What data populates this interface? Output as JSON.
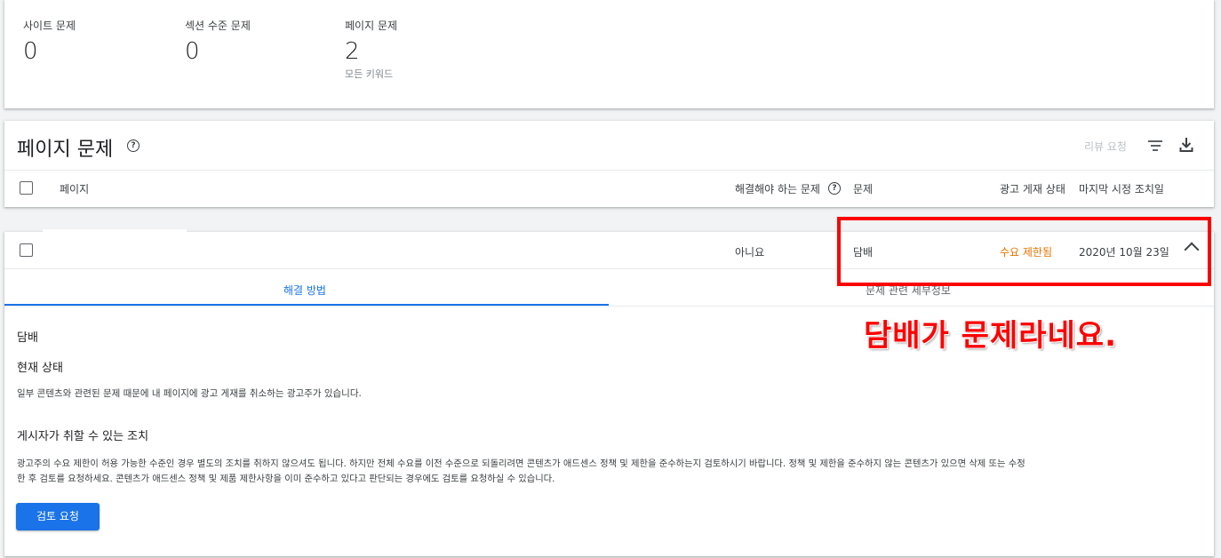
{
  "summary": {
    "site_label": "사이트 문제",
    "site_value": "0",
    "section_label": "섹션 수준 문제",
    "section_value": "0",
    "page_label": "페이지 문제",
    "page_value": "2",
    "page_sub": "모든 키워드"
  },
  "issues": {
    "title": "페이지 문제",
    "help_icon": "help-circle-icon",
    "review_label": "리뷰 요청",
    "filter_icon": "filter-icon",
    "download_icon": "download-icon",
    "columns": {
      "page": "페이지",
      "must_fix": "해결해야 하는 문제",
      "issue": "문제",
      "ad_status": "광고 게재 상태",
      "last_action": "마지막 시정 조치일"
    }
  },
  "row": {
    "must_fix": "아니요",
    "issue": "담배",
    "ad_status": "수요 제한됨",
    "ad_status_color": "#e37400",
    "last_action": "2020년 10월 23일"
  },
  "detail": {
    "tab_fix": "해결 방법",
    "tab_details": "문제 관련 세부정보",
    "issue_name": "담배",
    "current_status_heading": "현재 상태",
    "current_status_text": "일부 콘텐츠와 관련된 문제 때문에 내 페이지에 광고 게재를 취소하는 광고주가 있습니다.",
    "actions_heading": "게시자가 취할 수 있는 조치",
    "actions_text_line1": "광고주의 수요 제한이 허용 가능한 수준인 경우 별도의 조치를 취하지 않으셔도 됩니다. 하지만 전체 수요를 이전 수준으로 되돌리려면 콘텐츠가 애드센스 정책 및 제한을 준수하는지 검토하시기 바랍니다. 정책 및 제한을 준수하지 않는 콘텐츠가 있으면 삭제 또는 수정",
    "actions_text_line2": "한 후 검토를 요청하세요. 콘텐츠가 애드센스 정책 및 제품 제한사항을 이미 준수하고 있다고 판단되는 경우에도 검토를 요청하실 수 있습니다.",
    "review_button": "검토 요청"
  },
  "annotation": {
    "text": "담배가 문제라네요.",
    "color": "#ff0000"
  },
  "colors": {
    "accent": "#1a73e8",
    "warning": "#e37400"
  }
}
